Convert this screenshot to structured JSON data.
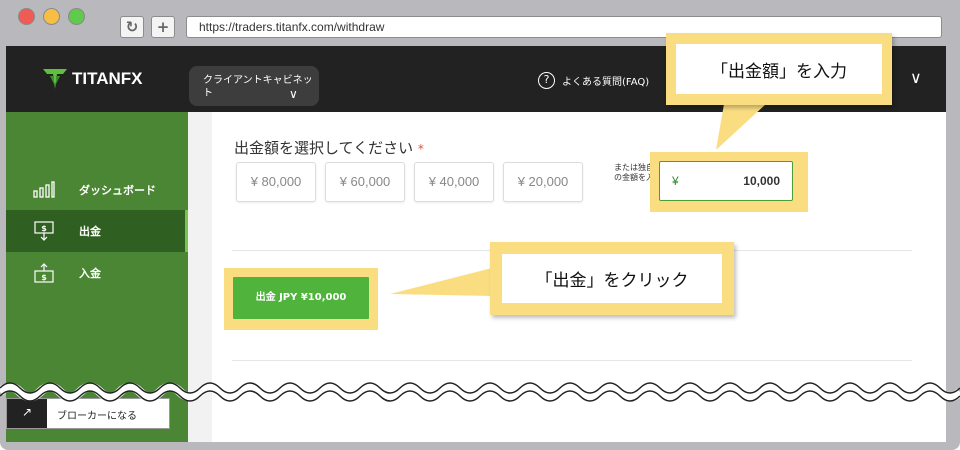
{
  "browser": {
    "url": "https://traders.titanfx.com/withdraw",
    "reload_icon": "reload-icon",
    "new_tab_icon": "plus-icon"
  },
  "header": {
    "logo_text": "TITANFX",
    "cabinet_label": "クライアントキャビネット",
    "faq_label": "よくある質問(FAQ)"
  },
  "sidebar": {
    "items": [
      {
        "label": "ダッシュボード",
        "icon": "bar-chart-icon"
      },
      {
        "label": "出金",
        "icon": "withdraw-icon",
        "active": true
      },
      {
        "label": "入金",
        "icon": "deposit-icon"
      }
    ],
    "broker_label": "ブローカーになる"
  },
  "main": {
    "amount_title": "出金額を選択してください",
    "required_mark": "*",
    "presets": [
      "¥ 80,000",
      "¥ 60,000",
      "¥ 40,000",
      "¥ 20,000"
    ],
    "custom_hint": "または独自の金額を入",
    "input_currency": "¥",
    "input_value": "10,000",
    "withdraw_button": "出金 JPY ¥10,000"
  },
  "annotations": {
    "enter_amount": "「出金額」を入力",
    "click_withdraw": "「出金」をクリック"
  },
  "colors": {
    "sidebar_green": "#4a8633",
    "active_green": "#2f5f21",
    "button_green": "#4fb33c",
    "highlight_yellow": "#fbdd81",
    "topbar": "#222222"
  }
}
